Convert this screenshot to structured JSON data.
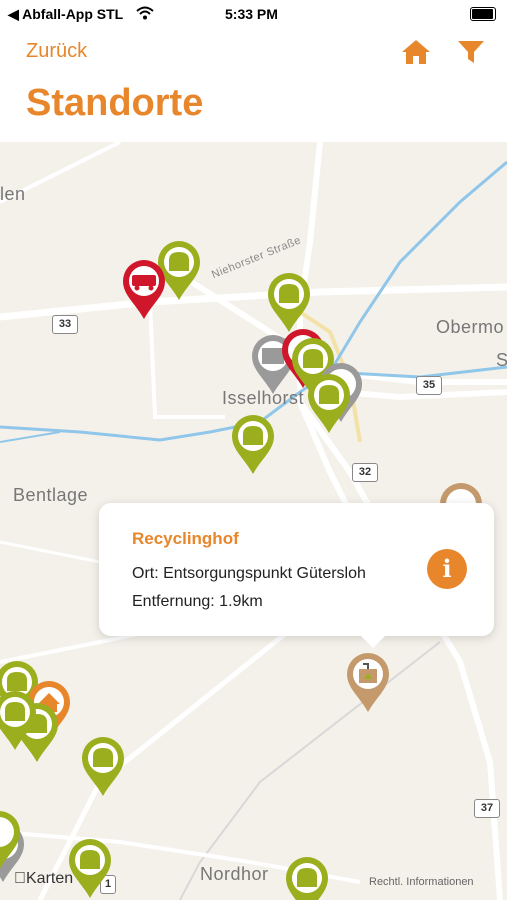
{
  "status_bar": {
    "back_app": "◀ Abfall-App STL",
    "time": "5:33 PM"
  },
  "nav": {
    "back_label": "Zurück",
    "title": "Standorte",
    "home_icon": "home-icon",
    "filter_icon": "filter-icon",
    "accent": "#e8862b"
  },
  "map": {
    "labels": {
      "len": "len",
      "niehorster": "Niehorster Straße",
      "isselhorst": "Isselhorst",
      "obermo": "Obermo",
      "s": "S",
      "bentlage": "Bentlage",
      "nordhorn": "Nordhor"
    },
    "roads": {
      "r33": "33",
      "r35": "35",
      "r32": "32",
      "r37": "37",
      "r1": "1"
    },
    "logo": "Karten",
    "legal": "Rechtl. Informationen"
  },
  "popup": {
    "title": "Recyclinghof",
    "ort": "Ort: Entsorgungspunkt Gütersloh",
    "entfernung": "Entfernung: 1.9km",
    "info_icon": "info-icon"
  },
  "colors": {
    "green_pin": "#9aae1e",
    "red_pin": "#d0162a",
    "gray_pin": "#9a9a9a",
    "orange_pin": "#e8862b",
    "brown_pin": "#c49a6c"
  }
}
